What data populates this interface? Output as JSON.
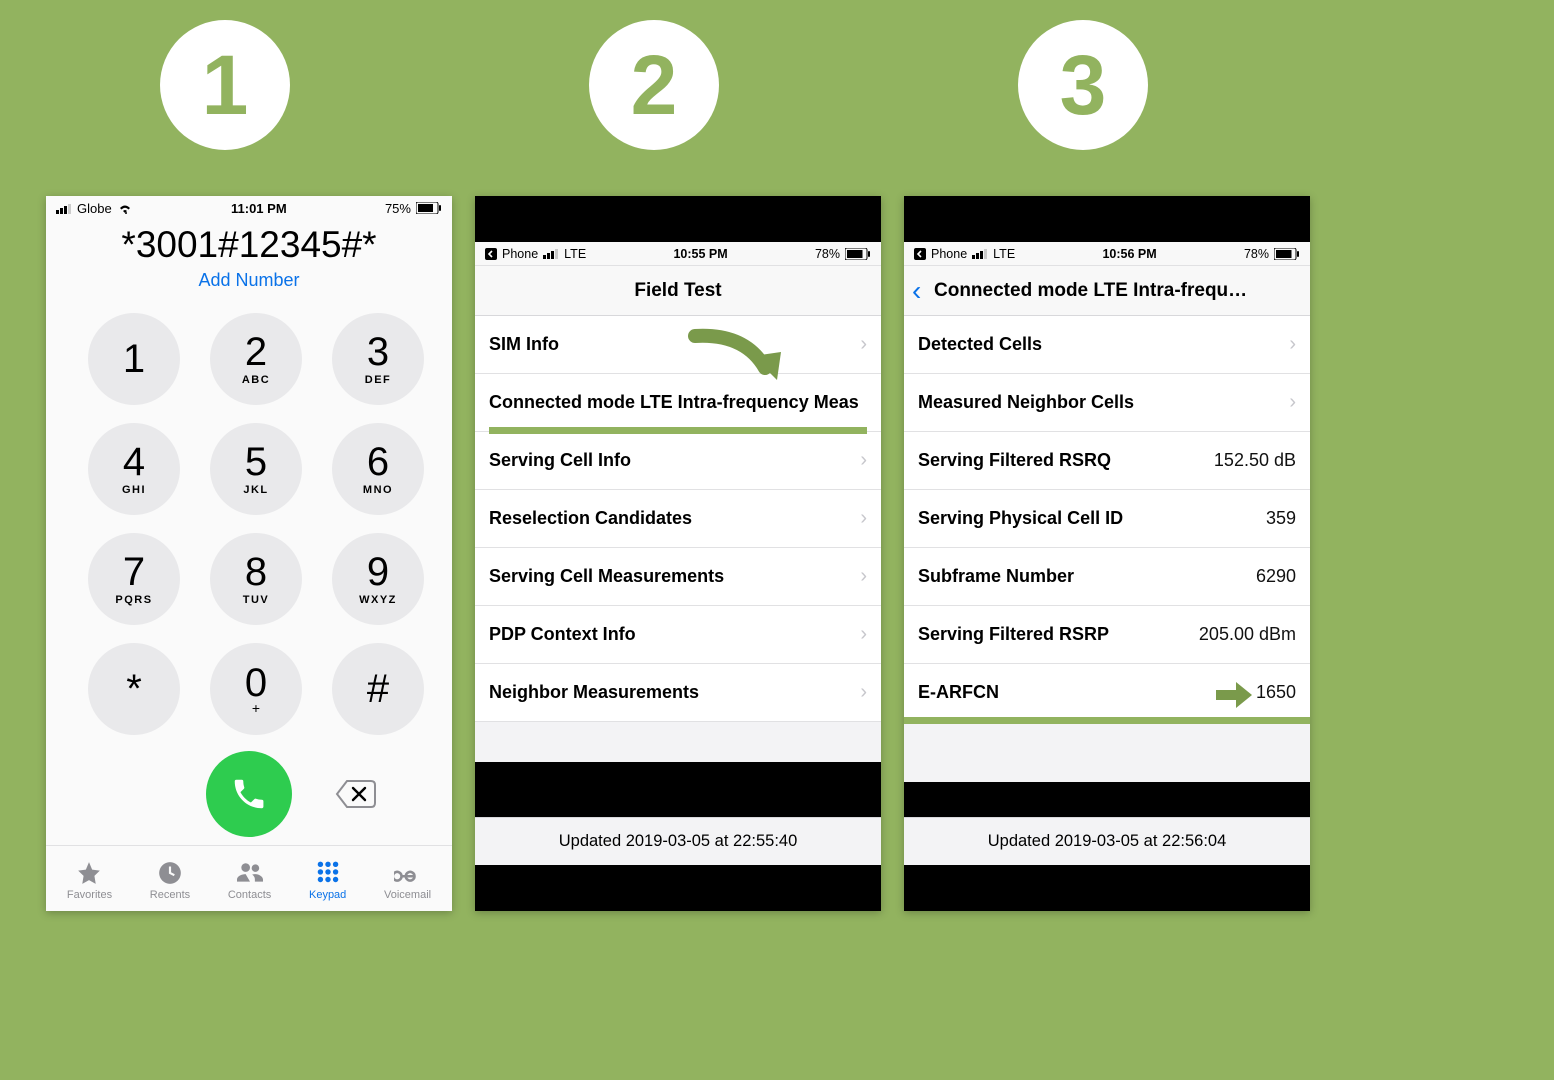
{
  "steps": {
    "one": "1",
    "two": "2",
    "three": "3"
  },
  "screen1": {
    "status": {
      "carrier": "Globe",
      "time": "11:01 PM",
      "battery": "75%"
    },
    "dialed": "*3001#12345#*",
    "add_number": "Add Number",
    "keys": [
      {
        "digit": "1",
        "letters": ""
      },
      {
        "digit": "2",
        "letters": "ABC"
      },
      {
        "digit": "3",
        "letters": "DEF"
      },
      {
        "digit": "4",
        "letters": "GHI"
      },
      {
        "digit": "5",
        "letters": "JKL"
      },
      {
        "digit": "6",
        "letters": "MNO"
      },
      {
        "digit": "7",
        "letters": "PQRS"
      },
      {
        "digit": "8",
        "letters": "TUV"
      },
      {
        "digit": "9",
        "letters": "WXYZ"
      },
      {
        "digit": "*",
        "letters": ""
      },
      {
        "digit": "0",
        "letters": "+"
      },
      {
        "digit": "#",
        "letters": ""
      }
    ],
    "tabs": {
      "favorites": "Favorites",
      "recents": "Recents",
      "contacts": "Contacts",
      "keypad": "Keypad",
      "voicemail": "Voicemail"
    }
  },
  "screen2": {
    "status": {
      "back_app": "Phone",
      "network": "LTE",
      "time": "10:55 PM",
      "battery": "78%"
    },
    "title": "Field Test",
    "rows": [
      "SIM Info",
      "Connected mode LTE Intra-frequency Meas",
      "Serving Cell Info",
      "Reselection Candidates",
      "Serving Cell Measurements",
      "PDP Context Info",
      "Neighbor Measurements"
    ],
    "footer": "Updated 2019-03-05 at 22:55:40"
  },
  "screen3": {
    "status": {
      "back_app": "Phone",
      "network": "LTE",
      "time": "10:56 PM",
      "battery": "78%"
    },
    "title": "Connected mode LTE Intra-frequ…",
    "rows": [
      {
        "label": "Detected Cells",
        "value": "",
        "chevron": true
      },
      {
        "label": "Measured Neighbor Cells",
        "value": "",
        "chevron": true
      },
      {
        "label": "Serving Filtered RSRQ",
        "value": "152.50 dB",
        "chevron": false
      },
      {
        "label": "Serving Physical Cell ID",
        "value": "359",
        "chevron": false
      },
      {
        "label": "Subframe Number",
        "value": "6290",
        "chevron": false
      },
      {
        "label": "Serving Filtered RSRP",
        "value": "205.00 dBm",
        "chevron": false
      },
      {
        "label": "E-ARFCN",
        "value": "1650",
        "chevron": false
      }
    ],
    "footer": "Updated 2019-03-05 at 22:56:04"
  }
}
